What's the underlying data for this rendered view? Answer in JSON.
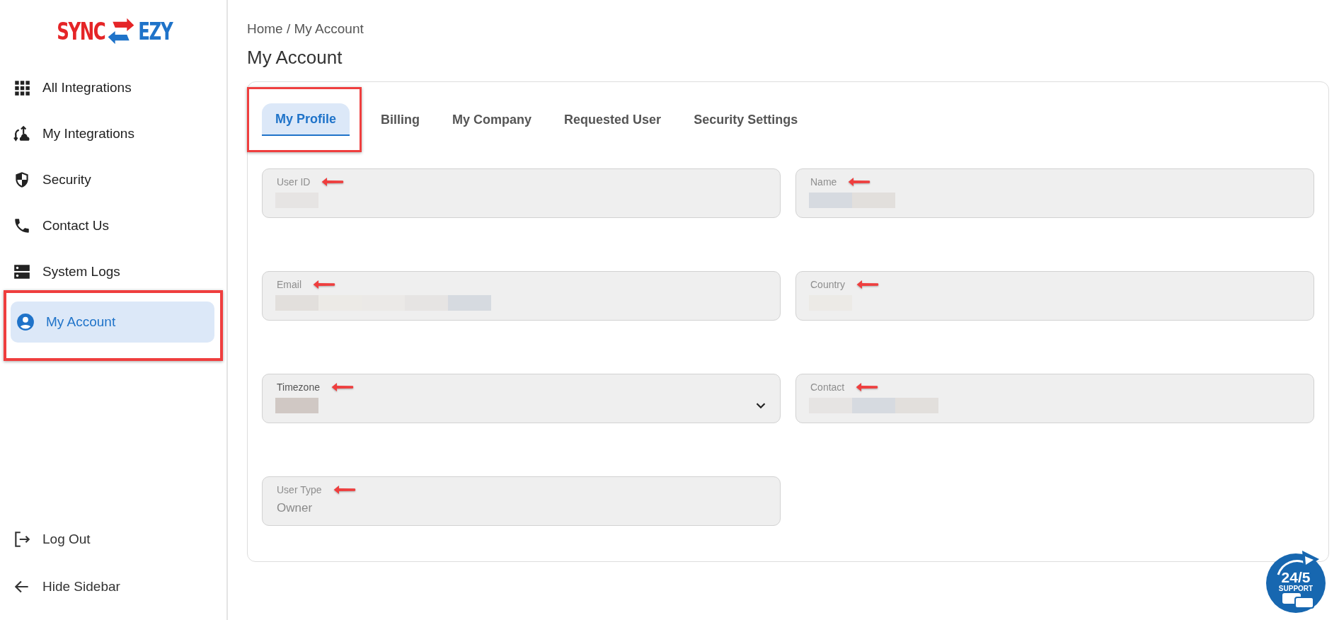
{
  "logo": {
    "left": "SYNC",
    "right": "EZY"
  },
  "sidebar": {
    "items": [
      {
        "label": "All Integrations",
        "kind": "grid",
        "selected": false,
        "highlighted": false
      },
      {
        "label": "My Integrations",
        "kind": "sync",
        "selected": false,
        "highlighted": false
      },
      {
        "label": "Security",
        "kind": "shield",
        "selected": false,
        "highlighted": false
      },
      {
        "label": "Contact Us",
        "kind": "phone",
        "selected": false,
        "highlighted": false
      },
      {
        "label": "System Logs",
        "kind": "server",
        "selected": false,
        "highlighted": false
      },
      {
        "label": "My Account",
        "kind": "user",
        "selected": true,
        "highlighted": true
      }
    ],
    "footer": [
      {
        "label": "Log Out",
        "kind": "logout"
      },
      {
        "label": "Hide Sidebar",
        "kind": "back"
      }
    ]
  },
  "breadcrumb": "Home / My Account",
  "title": "My Account",
  "tabs": [
    {
      "label": "My Profile",
      "selected": true,
      "highlighted": true
    },
    {
      "label": "Billing",
      "selected": false,
      "highlighted": false
    },
    {
      "label": "My Company",
      "selected": false,
      "highlighted": false
    },
    {
      "label": "Requested User",
      "selected": false,
      "highlighted": false
    },
    {
      "label": "Security Settings",
      "selected": false,
      "highlighted": false
    }
  ],
  "fields": [
    {
      "label": "User ID",
      "kind": "text",
      "disabled": true,
      "redacted": true,
      "annotated": true
    },
    {
      "label": "Name",
      "kind": "text",
      "disabled": true,
      "redacted": true,
      "annotated": true
    },
    {
      "label": "Email",
      "kind": "text",
      "disabled": true,
      "redacted": true,
      "annotated": true
    },
    {
      "label": "Country",
      "kind": "text",
      "disabled": true,
      "redacted": true,
      "annotated": true
    },
    {
      "label": "Timezone",
      "kind": "select",
      "disabled": false,
      "redacted": true,
      "annotated": true
    },
    {
      "label": "Contact",
      "kind": "text",
      "disabled": true,
      "redacted": true,
      "annotated": true
    },
    {
      "label": "User Type",
      "kind": "text",
      "disabled": true,
      "redacted": false,
      "value": "Owner",
      "annotated": true
    }
  ],
  "support_badge": {
    "top": "24/5",
    "bottom": "SUPPORT"
  }
}
